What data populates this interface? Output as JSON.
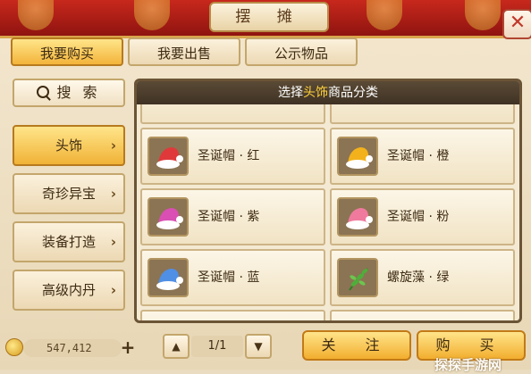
{
  "window": {
    "title": "摆 摊",
    "close_label": "✕"
  },
  "tabs": [
    {
      "label": "我要购买",
      "active": true
    },
    {
      "label": "我要出售",
      "active": false
    },
    {
      "label": "公示物品",
      "active": false
    }
  ],
  "search": {
    "label": "搜 索",
    "icon": "search-icon"
  },
  "categories": [
    {
      "label": "头饰",
      "active": true
    },
    {
      "label": "奇珍异宝",
      "active": false
    },
    {
      "label": "装备打造",
      "active": false
    },
    {
      "label": "高级内丹",
      "active": false
    }
  ],
  "panel": {
    "header_prefix": "选择",
    "header_highlight": "头饰",
    "header_suffix": "商品分类"
  },
  "items": [
    {
      "name": "圣诞帽 · 红",
      "icon": "red-christmas-hat",
      "color": "#e0393b"
    },
    {
      "name": "圣诞帽 · 橙",
      "icon": "orange-christmas-hat",
      "color": "#f3b21c"
    },
    {
      "name": "圣诞帽 · 紫",
      "icon": "purple-christmas-hat",
      "color": "#d94fb3"
    },
    {
      "name": "圣诞帽 · 粉",
      "icon": "pink-christmas-hat",
      "color": "#f07a9e"
    },
    {
      "name": "圣诞帽 · 蓝",
      "icon": "blue-christmas-hat",
      "color": "#4f8fe6"
    },
    {
      "name": "螺旋藻 · 绿",
      "icon": "green-spirulina",
      "color": "#4fae3a"
    }
  ],
  "footer": {
    "money": "547,412",
    "page": "1/1",
    "follow_label": "关 注",
    "buy_label": "购 买"
  },
  "watermark": "探探手游网"
}
